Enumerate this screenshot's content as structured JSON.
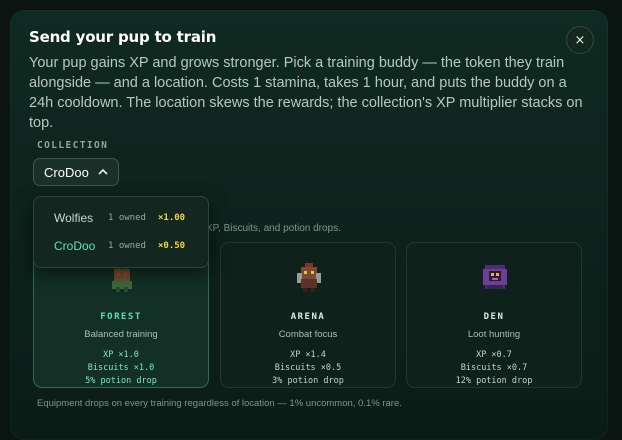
{
  "modal": {
    "title": "Send your pup to train",
    "description": "Your pup gains XP and grows stronger. Pick a training buddy — the token they train alongside — and a location. Costs 1 stamina, takes 1 hour, and puts the buddy on a 24h cooldown. The location skews the rewards; the collection's XP multiplier stacks on top.",
    "close_icon": "×"
  },
  "collection": {
    "label": "COLLECTION",
    "selected": "CroDoo",
    "chevron": "^",
    "options": [
      {
        "name": "Wolfies",
        "owned": "1 owned",
        "multiplier": "×1.00",
        "active": false
      },
      {
        "name": "CroDoo",
        "owned": "1 owned",
        "multiplier": "×0.50",
        "active": true
      }
    ]
  },
  "locations": {
    "hint_visible_tail": "XP, Biscuits, and potion drops.",
    "cards": [
      {
        "name": "FOREST",
        "subtitle": "Balanced training",
        "xp": "XP ×1.0",
        "biscuits": "Biscuits ×1.0",
        "potion": "5% potion drop",
        "selected": true
      },
      {
        "name": "ARENA",
        "subtitle": "Combat focus",
        "xp": "XP ×1.4",
        "biscuits": "Biscuits ×0.5",
        "potion": "3% potion drop",
        "selected": false
      },
      {
        "name": "DEN",
        "subtitle": "Loot hunting",
        "xp": "XP ×0.7",
        "biscuits": "Biscuits ×0.7",
        "potion": "12% potion drop",
        "selected": false
      }
    ]
  },
  "footnote": "Equipment drops on every training regardless of location — 1% uncommon, 0.1% rare.",
  "colors": {
    "accent": "#5ee0b4",
    "multiplier": "#f2d24a",
    "background": "#0f2a22"
  }
}
